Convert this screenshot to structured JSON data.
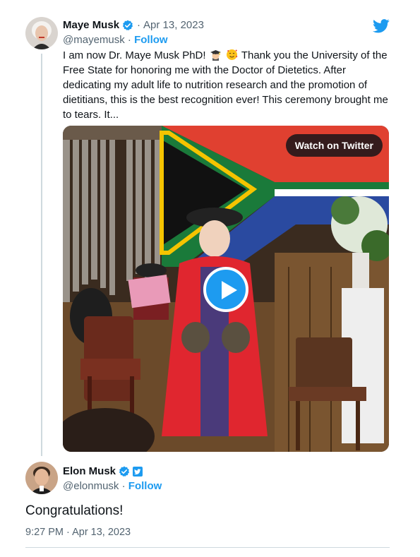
{
  "colors": {
    "accent": "#1d9bf0",
    "text_primary": "#0f1419",
    "text_secondary": "#536471",
    "divider": "#cfd9de"
  },
  "quoted_tweet": {
    "author_name": "Maye Musk",
    "handle": "@mayemusk",
    "separator": "·",
    "date": "Apr 13, 2023",
    "follow_label": "Follow",
    "verified_icon": "verified-badge-icon",
    "text_part1": "I am now Dr. Maye Musk PhD!",
    "emojis": [
      "graduation-cap-emoji",
      "smiling-face-with-hearts-emoji"
    ],
    "text_part2": "Thank you the University of the Free State for honoring me with the Doctor of Dietetics. After dedicating my adult life to nutrition research and the promotion of dietitians, this is the best recognition ever! This ceremony brought me to tears. It...",
    "media": {
      "watch_label": "Watch on Twitter",
      "play_icon": "play-icon"
    }
  },
  "main_tweet": {
    "author_name": "Elon Musk",
    "handle": "@elonmusk",
    "separator": "·",
    "follow_label": "Follow",
    "verified_icon": "verified-badge-icon",
    "affiliation_icon": "twitter-affiliation-icon",
    "text": "Congratulations!",
    "timestamp": "9:27 PM · Apr 13, 2023"
  },
  "brand_icon": "twitter-bird-icon"
}
